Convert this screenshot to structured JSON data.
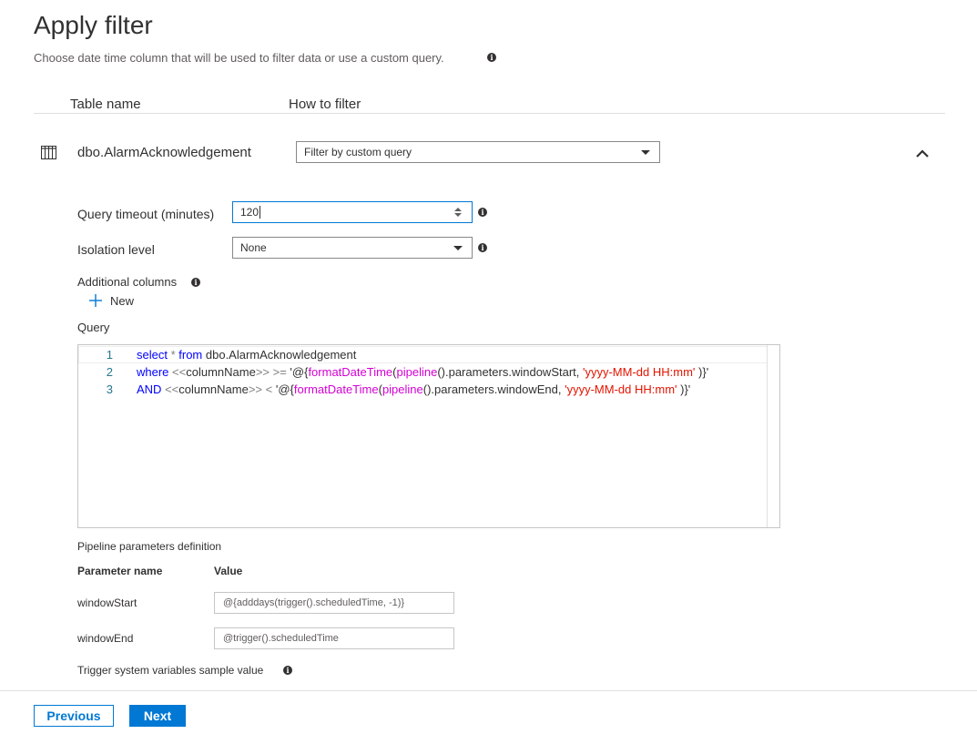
{
  "header": {
    "title": "Apply filter",
    "subtitle": "Choose date time column that will be used to filter data or use a custom query."
  },
  "columns": {
    "table_name": "Table name",
    "how_to_filter": "How to filter"
  },
  "table": {
    "name": "dbo.AlarmAcknowledgement",
    "filter_mode": "Filter by custom query"
  },
  "settings": {
    "query_timeout_label": "Query timeout (minutes)",
    "query_timeout_value": "120",
    "isolation_label": "Isolation level",
    "isolation_value": "None",
    "additional_columns_label": "Additional columns",
    "new_label": "New"
  },
  "query": {
    "label": "Query",
    "line_numbers": [
      "1",
      "2",
      "3"
    ],
    "lines": [
      [
        {
          "t": "kw",
          "s": "select"
        },
        {
          "t": "op",
          "s": " * "
        },
        {
          "t": "kw",
          "s": "from"
        },
        {
          "t": "tx",
          "s": " dbo.AlarmAcknowledgement"
        }
      ],
      [
        {
          "t": "kw",
          "s": "where"
        },
        {
          "t": "op",
          "s": " <<"
        },
        {
          "t": "tx",
          "s": "columnName"
        },
        {
          "t": "op",
          "s": ">> >= "
        },
        {
          "t": "tx",
          "s": "'@{"
        },
        {
          "t": "fn",
          "s": "formatDateTime"
        },
        {
          "t": "tx",
          "s": "("
        },
        {
          "t": "fn",
          "s": "pipeline"
        },
        {
          "t": "tx",
          "s": "().parameters.windowStart, "
        },
        {
          "t": "str",
          "s": "'yyyy-MM-dd HH:mm'"
        },
        {
          "t": "tx",
          "s": " )}'"
        }
      ],
      [
        {
          "t": "kw",
          "s": "AND"
        },
        {
          "t": "op",
          "s": " <<"
        },
        {
          "t": "tx",
          "s": "columnName"
        },
        {
          "t": "op",
          "s": ">> < "
        },
        {
          "t": "tx",
          "s": "'@{"
        },
        {
          "t": "fn",
          "s": "formatDateTime"
        },
        {
          "t": "tx",
          "s": "("
        },
        {
          "t": "fn",
          "s": "pipeline"
        },
        {
          "t": "tx",
          "s": "().parameters.windowEnd, "
        },
        {
          "t": "str",
          "s": "'yyyy-MM-dd HH:mm'"
        },
        {
          "t": "tx",
          "s": " )}'"
        }
      ]
    ]
  },
  "pipeline_params": {
    "section_label": "Pipeline parameters definition",
    "name_header": "Parameter name",
    "value_header": "Value",
    "rows": [
      {
        "name": "windowStart",
        "value": "@{adddays(trigger().scheduledTime, -1)}"
      },
      {
        "name": "windowEnd",
        "value": "@trigger().scheduledTime"
      }
    ],
    "trigger_label": "Trigger system variables sample value"
  },
  "footer": {
    "previous": "Previous",
    "next": "Next"
  },
  "colors": {
    "accent": "#0078d4",
    "keyword": "#0000ff",
    "function": "#d400d4",
    "string": "#e51400"
  },
  "icons": {
    "info": "info-icon",
    "table": "table-icon",
    "chevron": "chevron-up-icon",
    "caret": "chevron-down-icon",
    "add": "plus-icon",
    "spinner": "spinner-icon"
  }
}
